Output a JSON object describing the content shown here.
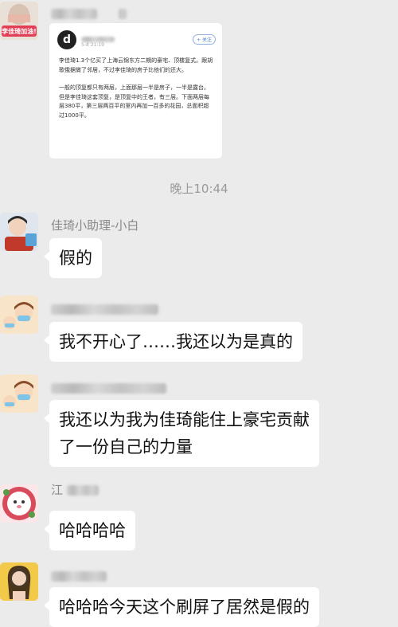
{
  "first_message": {
    "sticker_text": "李佳琦加油!",
    "card": {
      "logo_letter": "d",
      "time": "5-8 21:19",
      "follow_label": "+ 关注",
      "paragraphs": [
        "李佳琦1.3个亿买了上海云锦东方二期的豪宅、顶楼复式。跟胡歌俄据做了邻居，不过李佳琦的房子比他们的还大。",
        "一般的顶复都只有两层，上面那层一半是房子，一半是露台。但是李佳琦这套顶复，是顶复中的王者，有三层。下面两层每层380平，第三层两百平的室内再加一百多的花园，总面积超过1000平。"
      ]
    }
  },
  "timestamp": "晚上10:44",
  "messages": [
    {
      "sender": "佳琦小助理-小白",
      "text": "假的"
    },
    {
      "sender": "",
      "text": "我不开心了……我还以为是真的"
    },
    {
      "sender": "",
      "text_lines": [
        "我还以为我为佳琦能住上豪宅贡献",
        "了一份自己的力量"
      ]
    },
    {
      "sender": "江",
      "text": "哈哈哈哈"
    },
    {
      "sender": "",
      "text": "哈哈哈今天这个刷屏了居然是假的"
    }
  ]
}
